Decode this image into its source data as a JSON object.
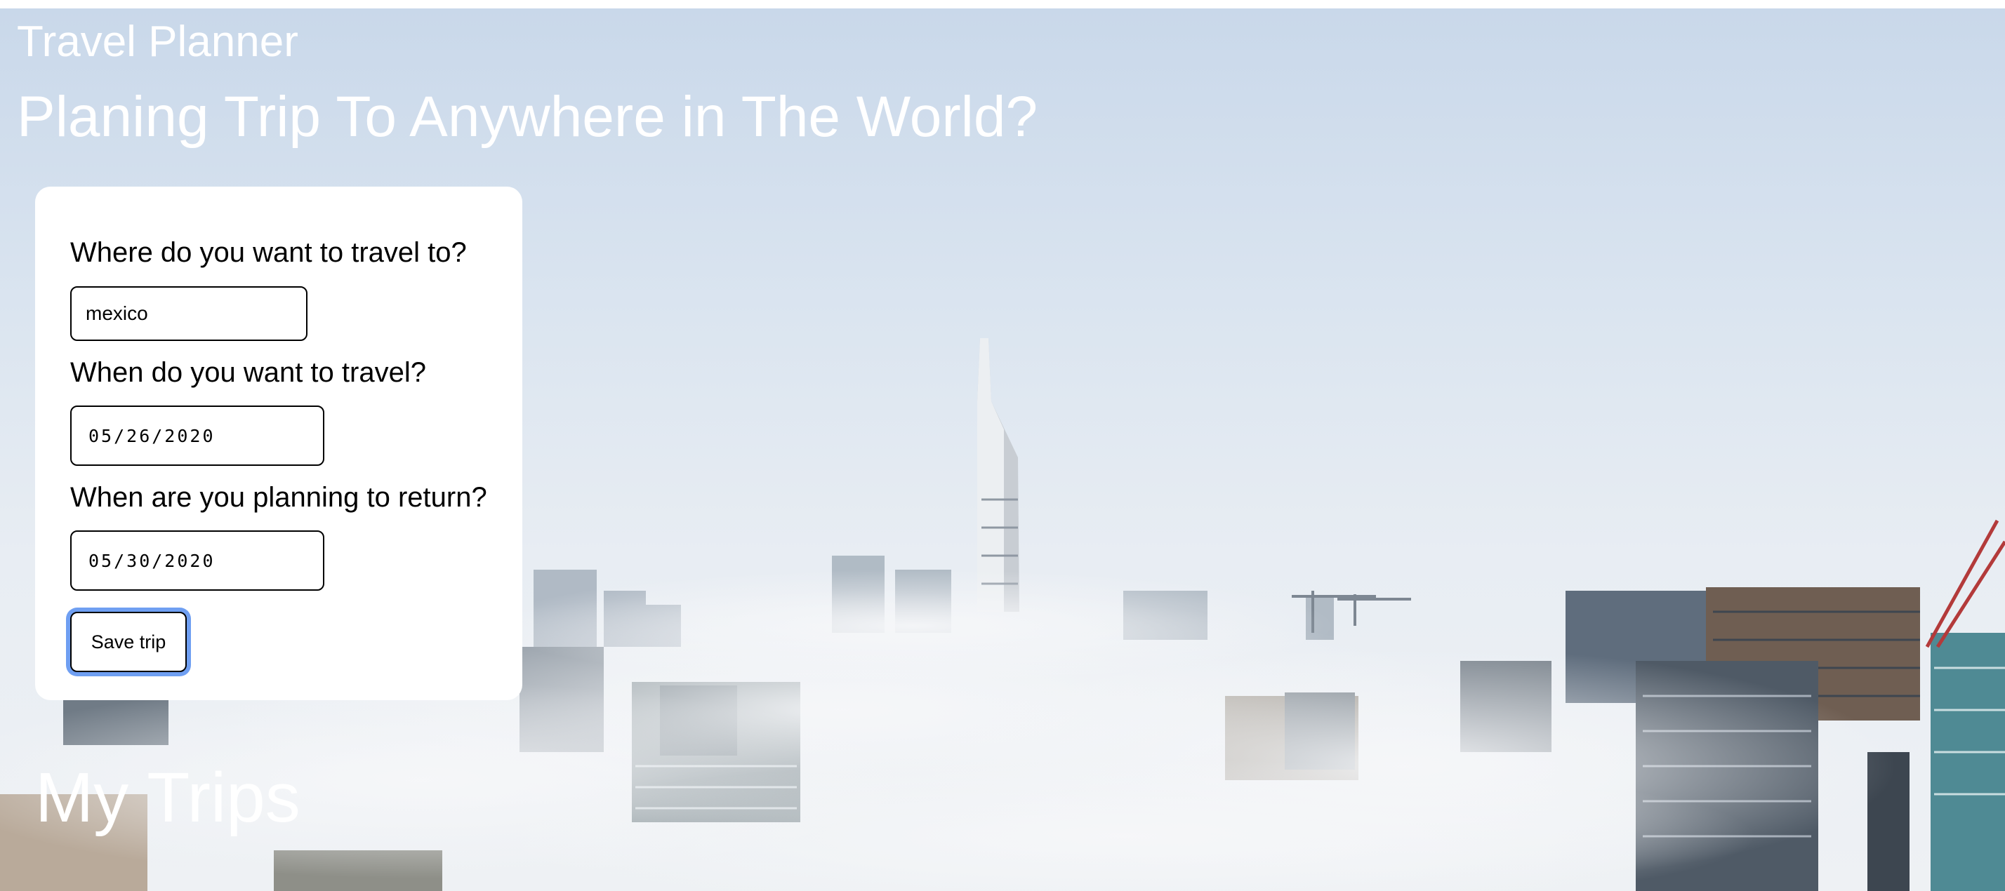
{
  "header": {
    "app_title": "Travel Planner",
    "hero_heading": "Planing Trip To Anywhere in The World?"
  },
  "form": {
    "destination": {
      "label": "Where do you want to travel to?",
      "value": "mexico"
    },
    "departure": {
      "label": "When do you want to travel?",
      "value": "05/26/2020"
    },
    "return": {
      "label": "When are you planning to return?",
      "value": "05/30/2020"
    },
    "save_label": "Save trip"
  },
  "trips": {
    "heading": "My Trips"
  },
  "colors": {
    "sky": "#c9d8ea",
    "fog": "#eef1f4",
    "focus_ring": "#6f9ff2",
    "card": "#ffffff"
  }
}
